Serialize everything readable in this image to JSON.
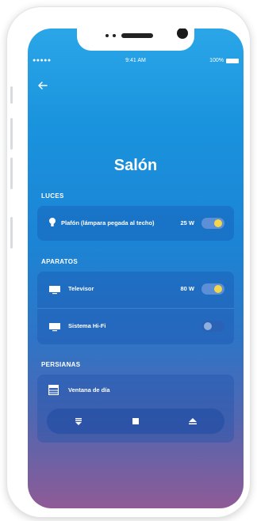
{
  "status_bar": {
    "signal": "●●●●● ",
    "time": "9:41 AM",
    "battery": "100%"
  },
  "header": {
    "title": "Salón"
  },
  "sections": {
    "luces": {
      "label": "LUCES",
      "items": [
        {
          "icon": "lightbulb-icon",
          "name": "Plafón (lámpara pegada al techo)",
          "watts": "25 W",
          "on": true
        }
      ]
    },
    "aparatos": {
      "label": "APARATOS",
      "items": [
        {
          "icon": "tv-icon",
          "name": "Televisor",
          "watts": "80 W",
          "on": true
        },
        {
          "icon": "tv-icon",
          "name": "Sistema Hi-Fi",
          "watts": "",
          "on": false
        }
      ]
    },
    "persianas": {
      "label": "PERSIANAS",
      "items": [
        {
          "icon": "blinds-icon",
          "name": "Ventana de día"
        }
      ],
      "controls": [
        "arrow-down-icon",
        "stop-icon",
        "eject-up-icon"
      ]
    }
  },
  "colors": {
    "toggle_on_knob": "#f2d64b",
    "gradient_top": "#2aa6e8",
    "gradient_bottom": "#8f5b96"
  }
}
